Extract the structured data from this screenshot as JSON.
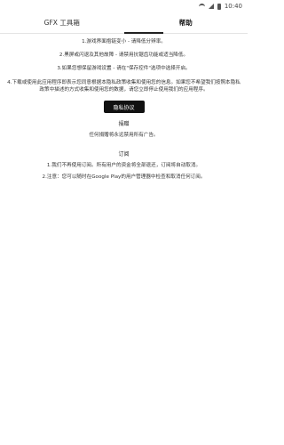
{
  "status_bar": {
    "time": "10:40"
  },
  "tabs": [
    {
      "label": "GFX 工具箱"
    },
    {
      "label": "帮助"
    }
  ],
  "help": {
    "lines": [
      "1.游戏界面抱链变小 - 请降低分辨率。",
      "2.黑屏或闪退及其他故障 - 请禁用抗锯齿功能或适当降低。",
      "3.如果您想保留游戏设置 - 请在\"保存控件\"选项中选择开启。",
      "4.下载或使用此应用程序即表示您同意根据本隐私政策收集和使用您的信息。如果您不希望我们按照本隐私政策中描述的方式收集和使用您的数据，请您立即停止使用我们的应用程序。"
    ],
    "privacy_button": "隐私协议"
  },
  "donate": {
    "title": "捐赠",
    "text": "任何捐赠将永远禁用所有广告。"
  },
  "subscription": {
    "title": "订阅",
    "lines": [
      "1.我们不再使用订阅。所有用户的资金将全部退还，订阅将自动取消。",
      "2.注意：您可以随时在Google Play的用户管理器中检查和取消任何订阅。"
    ]
  }
}
